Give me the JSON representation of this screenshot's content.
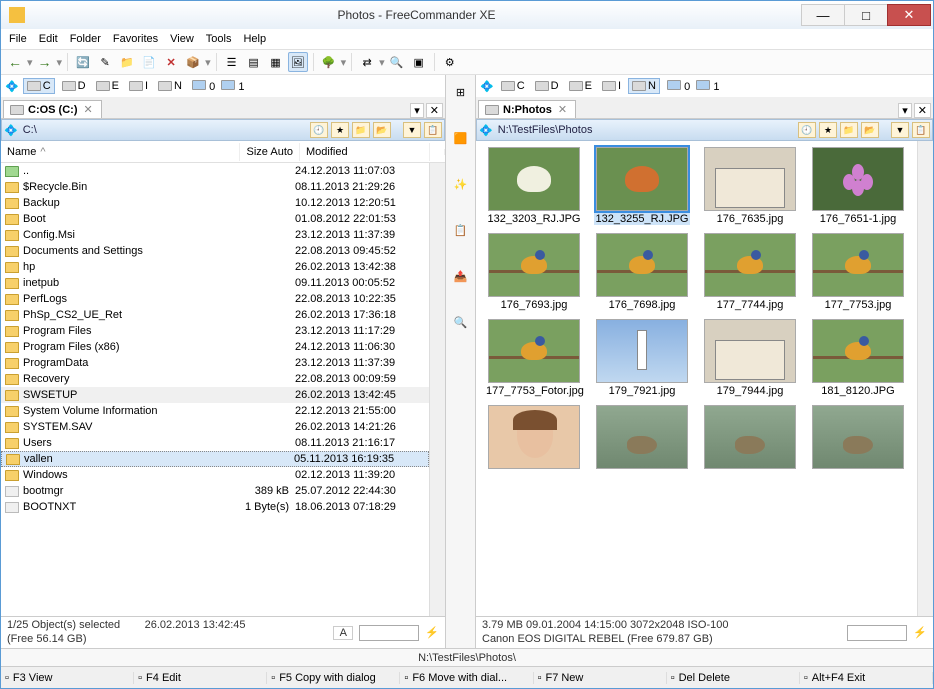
{
  "title": "Photos - FreeCommander XE",
  "menus": [
    "File",
    "Edit",
    "Folder",
    "Favorites",
    "View",
    "Tools",
    "Help"
  ],
  "left": {
    "tab": "C:OS (C:)",
    "path": "C:\\",
    "drives": [
      {
        "l": "C",
        "sel": true
      },
      {
        "l": "D"
      },
      {
        "l": "E"
      },
      {
        "l": "I"
      },
      {
        "l": "N"
      }
    ],
    "drive_counts": {
      "zero": "0",
      "one": "1"
    },
    "cols": {
      "name": "Name",
      "size": "Size Auto",
      "modified": "Modified"
    },
    "rows": [
      {
        "n": "..",
        "m": "24.12.2013 11:07:03",
        "t": "up"
      },
      {
        "n": "$Recycle.Bin",
        "m": "08.11.2013 21:29:26",
        "t": "d"
      },
      {
        "n": "Backup",
        "m": "10.12.2013 12:20:51",
        "t": "d"
      },
      {
        "n": "Boot",
        "m": "01.08.2012 22:01:53",
        "t": "d"
      },
      {
        "n": "Config.Msi",
        "m": "23.12.2013 11:37:39",
        "t": "d"
      },
      {
        "n": "Documents and Settings",
        "m": "22.08.2013 09:45:52",
        "t": "d"
      },
      {
        "n": "hp",
        "m": "26.02.2013 13:42:38",
        "t": "d"
      },
      {
        "n": "inetpub",
        "m": "09.11.2013 00:05:52",
        "t": "d"
      },
      {
        "n": "PerfLogs",
        "m": "22.08.2013 10:22:35",
        "t": "d"
      },
      {
        "n": "PhSp_CS2_UE_Ret",
        "m": "26.02.2013 17:36:18",
        "t": "d"
      },
      {
        "n": "Program Files",
        "m": "23.12.2013 11:17:29",
        "t": "d"
      },
      {
        "n": "Program Files (x86)",
        "m": "24.12.2013 11:06:30",
        "t": "d"
      },
      {
        "n": "ProgramData",
        "m": "23.12.2013 11:37:39",
        "t": "d"
      },
      {
        "n": "Recovery",
        "m": "22.08.2013 00:09:59",
        "t": "d"
      },
      {
        "n": "SWSETUP",
        "m": "26.02.2013 13:42:45",
        "t": "d",
        "hl": true
      },
      {
        "n": "System Volume Information",
        "m": "22.12.2013 21:55:00",
        "t": "d"
      },
      {
        "n": "SYSTEM.SAV",
        "m": "26.02.2013 14:21:26",
        "t": "d"
      },
      {
        "n": "Users",
        "m": "08.11.2013 21:16:17",
        "t": "d"
      },
      {
        "n": "vallen",
        "m": "05.11.2013 16:19:35",
        "t": "d",
        "sel": true
      },
      {
        "n": "Windows",
        "m": "02.12.2013 11:39:20",
        "t": "d"
      },
      {
        "n": "bootmgr",
        "s": "389 kB",
        "m": "25.07.2012 22:44:30",
        "t": "f"
      },
      {
        "n": "BOOTNXT",
        "s": "1 Byte(s)",
        "m": "18.06.2013 07:18:29",
        "t": "f"
      }
    ],
    "status": {
      "line1": "1/25 Object(s) selected",
      "date": "26.02.2013 13:42:45",
      "line2": "(Free 56.14 GB)",
      "letter": "A"
    }
  },
  "right": {
    "tab": "N:Photos",
    "path": "N:\\TestFiles\\Photos",
    "drives": [
      {
        "l": "C"
      },
      {
        "l": "D"
      },
      {
        "l": "E"
      },
      {
        "l": "I"
      },
      {
        "l": "N",
        "sel": true
      }
    ],
    "drive_counts": {
      "zero": "0",
      "one": "1"
    },
    "thumbs": [
      {
        "n": "132_3203_RJ.JPG",
        "k": "butterfly1"
      },
      {
        "n": "132_3255_RJ.JPG",
        "k": "butterfly2",
        "sel": true
      },
      {
        "n": "176_7635.jpg",
        "k": "building"
      },
      {
        "n": "176_7651-1.jpg",
        "k": "flower"
      },
      {
        "n": "176_7693.jpg",
        "k": "bird"
      },
      {
        "n": "176_7698.jpg",
        "k": "bird"
      },
      {
        "n": "177_7744.jpg",
        "k": "bird"
      },
      {
        "n": "177_7753.jpg",
        "k": "bird"
      },
      {
        "n": "177_7753_Fotor.jpg",
        "k": "bird"
      },
      {
        "n": "179_7921.jpg",
        "k": "lighthouse"
      },
      {
        "n": "179_7944.jpg",
        "k": "building"
      },
      {
        "n": "181_8120.JPG",
        "k": "bird"
      },
      {
        "n": "",
        "k": "face"
      },
      {
        "n": "",
        "k": "duck"
      },
      {
        "n": "",
        "k": "duck"
      },
      {
        "n": "",
        "k": "duck"
      }
    ],
    "status": {
      "line1": "3.79 MB    09.01.2004 14:15:00    3072x2048    ISO-100",
      "line2": "Canon EOS DIGITAL REBEL   (Free 679.87 GB)"
    }
  },
  "pathbar": "N:\\TestFiles\\Photos\\",
  "fnkeys": [
    {
      "k": "F3 View"
    },
    {
      "k": "F4 Edit"
    },
    {
      "k": "F5 Copy with dialog"
    },
    {
      "k": "F6 Move with dial..."
    },
    {
      "k": "F7 New"
    },
    {
      "k": "Del Delete"
    },
    {
      "k": "Alt+F4 Exit"
    }
  ]
}
